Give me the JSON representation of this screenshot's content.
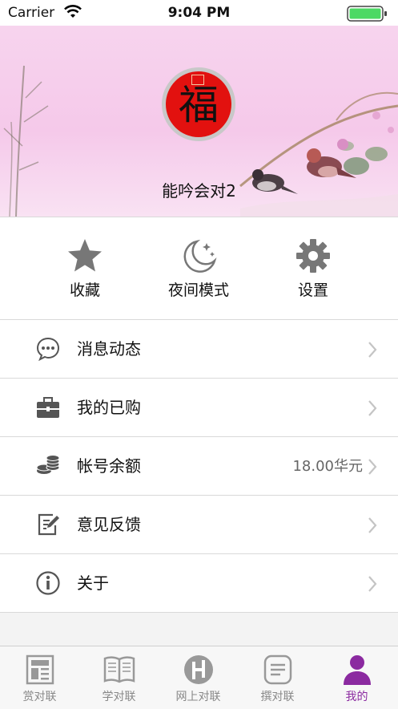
{
  "status_bar": {
    "carrier": "Carrier",
    "time": "9:04 PM"
  },
  "profile": {
    "username": "能吟会对2",
    "avatar_glyph": "福"
  },
  "quick_actions": [
    {
      "label": "收藏",
      "icon": "star-icon"
    },
    {
      "label": "夜间模式",
      "icon": "moon-icon"
    },
    {
      "label": "设置",
      "icon": "gear-icon"
    }
  ],
  "menu": [
    {
      "label": "消息动态",
      "icon": "message-icon",
      "value": ""
    },
    {
      "label": "我的已购",
      "icon": "briefcase-icon",
      "value": ""
    },
    {
      "label": "帐号余额",
      "icon": "coins-icon",
      "value": "18.00华元"
    },
    {
      "label": "意见反馈",
      "icon": "feedback-icon",
      "value": ""
    },
    {
      "label": "关于",
      "icon": "info-icon",
      "value": ""
    }
  ],
  "tabs": [
    {
      "label": "赏对联",
      "icon": "newspaper-icon",
      "active": false
    },
    {
      "label": "学对联",
      "icon": "book-icon",
      "active": false
    },
    {
      "label": "网上对联",
      "icon": "globe-icon",
      "active": false
    },
    {
      "label": "撰对联",
      "icon": "document-icon",
      "active": false
    },
    {
      "label": "我的",
      "icon": "person-icon",
      "active": true
    }
  ],
  "colors": {
    "accent": "#8b2aa0",
    "banner": "#f5c9ea",
    "avatar": "#e2110f",
    "icon_gray": "#777777",
    "battery": "#4cd964"
  }
}
